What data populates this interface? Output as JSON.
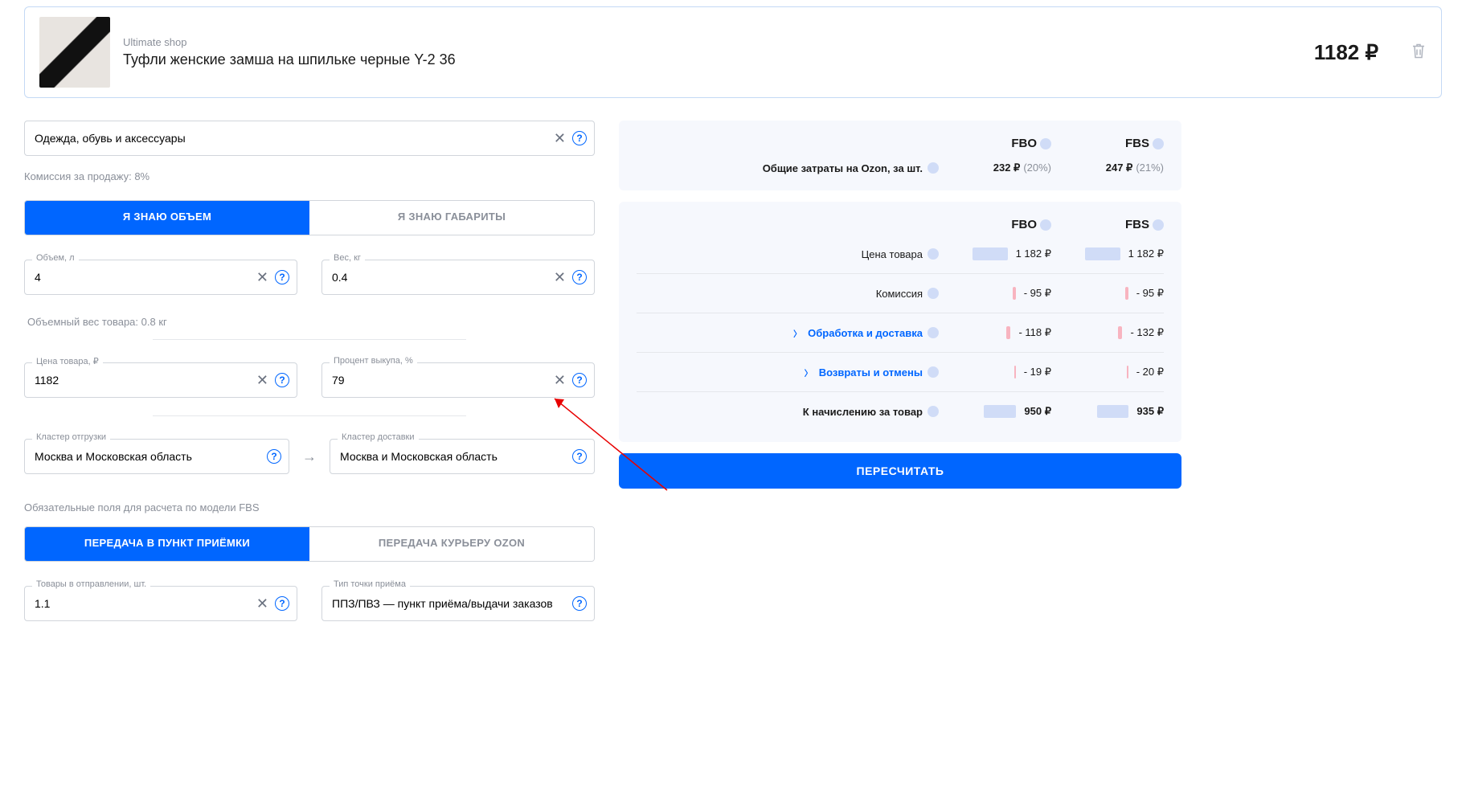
{
  "product": {
    "shop": "Ultimate shop",
    "title": "Туфли женские замша на шпильке черные Y-2 36",
    "price": "1182 ₽"
  },
  "category": {
    "label": "",
    "value": "Одежда, обувь и аксессуары"
  },
  "commission_note": "Комиссия за продажу: 8%",
  "tabs1": {
    "volume": "Я ЗНАЮ ОБЪЕМ",
    "dims": "Я ЗНАЮ ГАБАРИТЫ"
  },
  "volume_field": {
    "label": "Объем, л",
    "value": "4"
  },
  "weight_field": {
    "label": "Вес, кг",
    "value": "0.4"
  },
  "volumetric": "Объемный вес товара: 0.8 кг",
  "price_field": {
    "label": "Цена товара, ₽",
    "value": "1182"
  },
  "buyout_field": {
    "label": "Процент выкупа, %",
    "value": "79"
  },
  "cluster_from": {
    "label": "Кластер отгрузки",
    "value": "Москва и Московская область"
  },
  "cluster_to": {
    "label": "Кластер доставки",
    "value": "Москва и Московская область"
  },
  "fbs_note": "Обязательные поля для расчета по модели FBS",
  "tabs2": {
    "pickup": "ПЕРЕДАЧА В ПУНКТ ПРИЁМКИ",
    "courier": "ПЕРЕДАЧА КУРЬЕРУ OZON"
  },
  "ship_items": {
    "label": "Товары в отправлении, шт.",
    "value": "1.1"
  },
  "point_type": {
    "label": "Тип точки приёма",
    "value": "ППЗ/ПВЗ — пункт приёма/выдачи заказов"
  },
  "summary": {
    "fbo_label": "FBO",
    "fbs_label": "FBS",
    "total_costs_label": "Общие затраты на Ozon, за шт.",
    "fbo_cost": "232 ₽",
    "fbo_pct": "(20%)",
    "fbs_cost": "247 ₽",
    "fbs_pct": "(21%)"
  },
  "details": {
    "price_label": "Цена товара",
    "price_fbo": "1 182 ₽",
    "price_fbs": "1 182 ₽",
    "commission_label": "Комиссия",
    "commission_fbo": "- 95 ₽",
    "commission_fbs": "- 95 ₽",
    "delivery_label": "Обработка и доставка",
    "delivery_fbo": "- 118 ₽",
    "delivery_fbs": "- 132 ₽",
    "returns_label": "Возвраты и отмены",
    "returns_fbo": "- 19 ₽",
    "returns_fbs": "- 20 ₽",
    "net_label": "К начислению за товар",
    "net_fbo": "950 ₽",
    "net_fbs": "935 ₽"
  },
  "recalc": "ПЕРЕСЧИТАТЬ"
}
